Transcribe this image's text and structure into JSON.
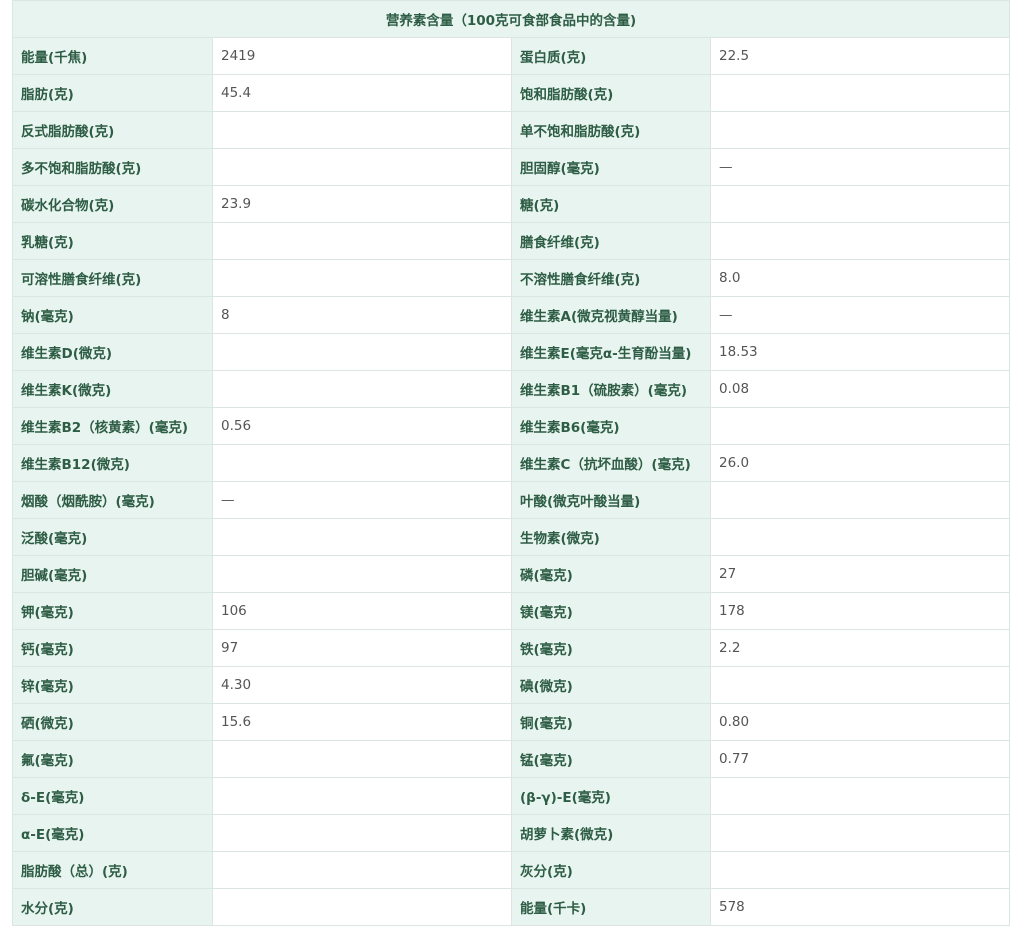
{
  "table": {
    "title": "营养素含量（100克可食部食品中的含量)",
    "rows": [
      [
        {
          "label": "能量(千焦)",
          "value": "2419"
        },
        {
          "label": "蛋白质(克)",
          "value": "22.5"
        }
      ],
      [
        {
          "label": "脂肪(克)",
          "value": "45.4"
        },
        {
          "label": "饱和脂肪酸(克)",
          "value": ""
        }
      ],
      [
        {
          "label": "反式脂肪酸(克)",
          "value": ""
        },
        {
          "label": "单不饱和脂肪酸(克)",
          "value": ""
        }
      ],
      [
        {
          "label": "多不饱和脂肪酸(克)",
          "value": ""
        },
        {
          "label": "胆固醇(毫克)",
          "value": "—"
        }
      ],
      [
        {
          "label": "碳水化合物(克)",
          "value": "23.9"
        },
        {
          "label": "糖(克)",
          "value": ""
        }
      ],
      [
        {
          "label": "乳糖(克)",
          "value": ""
        },
        {
          "label": "膳食纤维(克)",
          "value": ""
        }
      ],
      [
        {
          "label": "可溶性膳食纤维(克)",
          "value": ""
        },
        {
          "label": "不溶性膳食纤维(克)",
          "value": "8.0"
        }
      ],
      [
        {
          "label": "钠(毫克)",
          "value": "8"
        },
        {
          "label": "维生素A(微克视黄醇当量)",
          "value": "—"
        }
      ],
      [
        {
          "label": "维生素D(微克)",
          "value": ""
        },
        {
          "label": "维生素E(毫克α-生育酚当量)",
          "value": "18.53"
        }
      ],
      [
        {
          "label": "维生素K(微克)",
          "value": ""
        },
        {
          "label": "维生素B1（硫胺素）(毫克)",
          "value": "0.08"
        }
      ],
      [
        {
          "label": "维生素B2（核黄素）(毫克)",
          "value": "0.56"
        },
        {
          "label": "维生素B6(毫克)",
          "value": ""
        }
      ],
      [
        {
          "label": "维生素B12(微克)",
          "value": ""
        },
        {
          "label": "维生素C（抗坏血酸）(毫克)",
          "value": "26.0"
        }
      ],
      [
        {
          "label": "烟酸（烟酰胺）(毫克)",
          "value": "—"
        },
        {
          "label": "叶酸(微克叶酸当量)",
          "value": ""
        }
      ],
      [
        {
          "label": "泛酸(毫克)",
          "value": ""
        },
        {
          "label": "生物素(微克)",
          "value": ""
        }
      ],
      [
        {
          "label": "胆碱(毫克)",
          "value": ""
        },
        {
          "label": "磷(毫克)",
          "value": "27"
        }
      ],
      [
        {
          "label": "钾(毫克)",
          "value": "106"
        },
        {
          "label": "镁(毫克)",
          "value": "178"
        }
      ],
      [
        {
          "label": "钙(毫克)",
          "value": "97"
        },
        {
          "label": "铁(毫克)",
          "value": "2.2"
        }
      ],
      [
        {
          "label": "锌(毫克)",
          "value": "4.30"
        },
        {
          "label": "碘(微克)",
          "value": ""
        }
      ],
      [
        {
          "label": "硒(微克)",
          "value": "15.6"
        },
        {
          "label": "铜(毫克)",
          "value": "0.80"
        }
      ],
      [
        {
          "label": "氟(毫克)",
          "value": ""
        },
        {
          "label": "锰(毫克)",
          "value": "0.77"
        }
      ],
      [
        {
          "label": "δ-E(毫克)",
          "value": ""
        },
        {
          "label": "(β-γ)-E(毫克)",
          "value": ""
        }
      ],
      [
        {
          "label": "α-E(毫克)",
          "value": ""
        },
        {
          "label": "胡萝卜素(微克)",
          "value": ""
        }
      ],
      [
        {
          "label": "脂肪酸（总）(克)",
          "value": ""
        },
        {
          "label": "灰分(克)",
          "value": ""
        }
      ],
      [
        {
          "label": "水分(克)",
          "value": ""
        },
        {
          "label": "能量(千卡)",
          "value": "578"
        }
      ]
    ]
  }
}
